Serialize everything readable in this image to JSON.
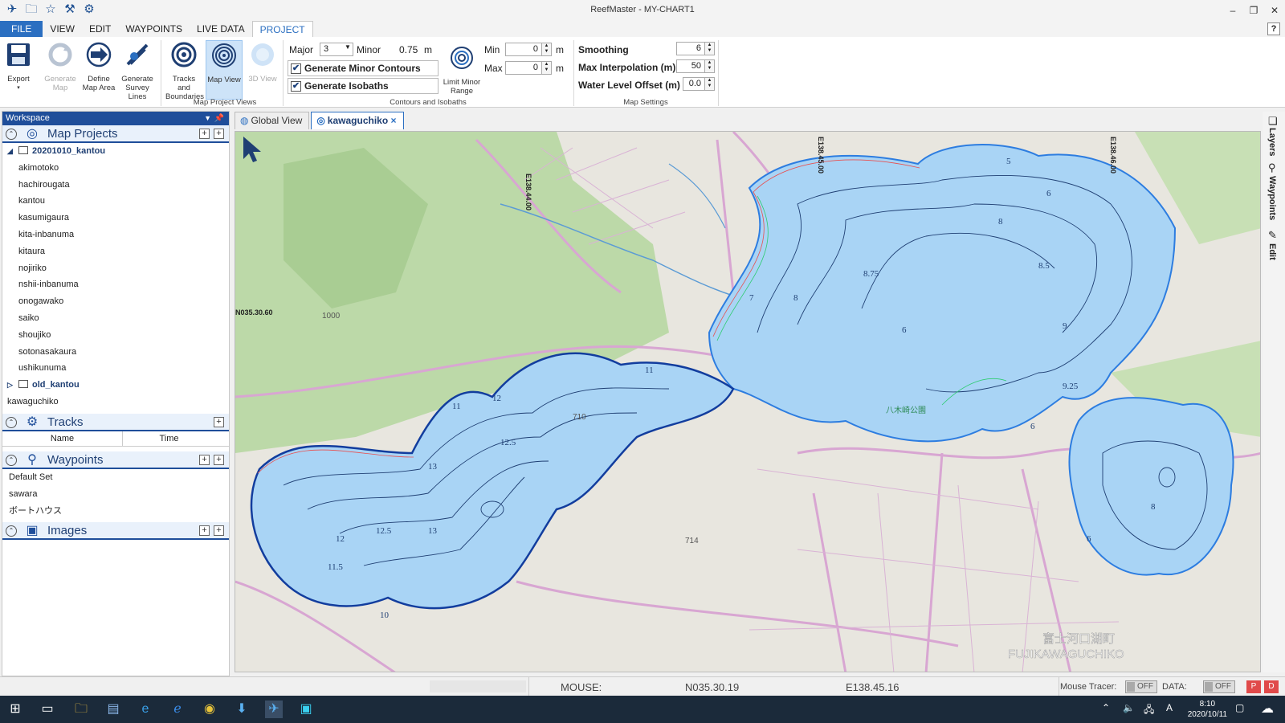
{
  "window": {
    "title": "ReefMaster - MY-CHART1"
  },
  "menu": {
    "file": "FILE",
    "items": [
      "VIEW",
      "EDIT",
      "WAYPOINTS",
      "LIVE DATA",
      "PROJECT"
    ],
    "help": "?"
  },
  "ribbon": {
    "export": "Export",
    "generate_map": "Generate Map",
    "define_map_area": "Define Map Area",
    "generate_survey_lines": "Generate Survey Lines",
    "tracks_and_boundaries": "Tracks and Boundaries",
    "map_view": "Map View",
    "view_3d": "3D View",
    "group_views": "Map Project Views",
    "major_label": "Major",
    "major_value": "3",
    "minor_label": "Minor",
    "minor_value": "0.75",
    "unit_m": "m",
    "gen_minor_contours": "Generate Minor Contours",
    "gen_isobaths": "Generate Isobaths",
    "limit_minor_range": "Limit Minor Range",
    "min_label": "Min",
    "min_value": "0",
    "max_label": "Max",
    "max_value": "0",
    "group_contours": "Contours and Isobaths",
    "smoothing_label": "Smoothing",
    "smoothing_value": "6",
    "max_interp_label": "Max Interpolation (m)",
    "max_interp_value": "50",
    "water_level_label": "Water Level Offset (m)",
    "water_level_value": "0.0",
    "group_map_settings": "Map Settings"
  },
  "workspace": {
    "title": "Workspace",
    "map_projects": {
      "label": "Map Projects",
      "folder": "20201010_kantou",
      "items": [
        "akimotoko",
        "hachirougata",
        "kantou",
        "kasumigaura",
        "kita-inbanuma",
        "kitaura",
        "nojiriko",
        "nshii-inbanuma",
        "onogawako",
        "saiko",
        "shoujiko",
        "sotonasakaura",
        "ushikunuma"
      ],
      "folder2": "old_kantou",
      "extra": "kawaguchiko"
    },
    "tracks": {
      "label": "Tracks",
      "col_name": "Name",
      "col_time": "Time"
    },
    "waypoints": {
      "label": "Waypoints",
      "items": [
        "Default Set",
        "sawara",
        "ボートハウス"
      ]
    },
    "images": {
      "label": "Images"
    }
  },
  "tabs": {
    "global": "Global View",
    "active": "kawaguchiko",
    "close": "×"
  },
  "map": {
    "lon1": "E138.44.00",
    "lon2": "E138.45.00",
    "lon3": "E138.46.00",
    "lat1": "N035.30.60",
    "park": "八木崎公園",
    "town_jp": "富士河口湖町",
    "town_en": "FUJIKAWAGUCHIKO",
    "depths": [
      "5",
      "6",
      "8",
      "8.5",
      "9",
      "7",
      "8",
      "8.75",
      "6",
      "11",
      "12",
      "13",
      "12.5",
      "12",
      "12.5",
      "13",
      "11.5",
      "10",
      "11",
      "9.25",
      "6",
      "8",
      "6"
    ],
    "road_num": "710",
    "road_num2": "714",
    "grid": "1000"
  },
  "right_tabs": {
    "layers": "Layers",
    "waypoints": "Waypoints",
    "edit": "Edit"
  },
  "status": {
    "mouse_label": "MOUSE:",
    "mouse_lat": "N035.30.19",
    "mouse_lon": "E138.45.16",
    "tracer_label": "Mouse Tracer:",
    "tracer_value": "OFF",
    "data_label": "DATA:",
    "data_value": "OFF",
    "btn_p": "P",
    "btn_d": "D"
  },
  "taskbar": {
    "time": "8:10",
    "date": "2020/10/11",
    "ime": "A"
  },
  "colors": {
    "accent": "#2b6fc1",
    "water": "#a9d4f5",
    "land": "#e8e6df",
    "forest": "#b9d8a5",
    "road": "#d59fd0"
  }
}
